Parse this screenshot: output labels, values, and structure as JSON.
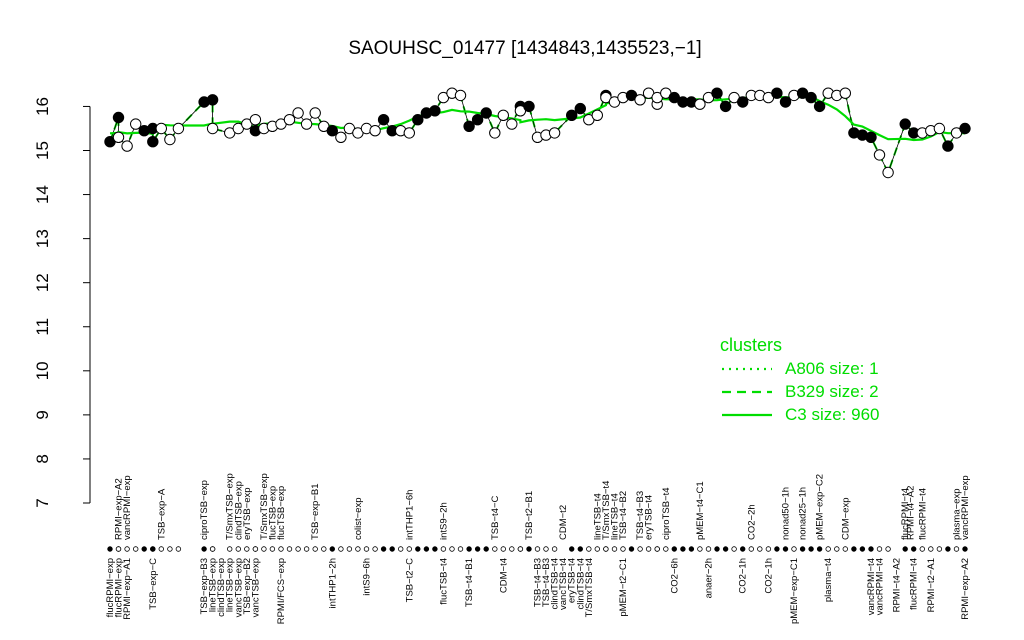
{
  "chart_data": {
    "type": "scatter",
    "title": "SAOUHSC_01477 [1434843,1435523,−1]",
    "xlabel": "",
    "ylabel": "",
    "ylim": [
      7,
      16.6
    ],
    "yticks": [
      7,
      8,
      9,
      10,
      11,
      12,
      13,
      14,
      15,
      16
    ],
    "x_count": 100,
    "top_labels": [
      {
        "i": 1,
        "label": "RPMI−exp−A2"
      },
      {
        "i": 2,
        "label": "vancRPMI−exp"
      },
      {
        "i": 6,
        "label": "TSB−exp−A"
      },
      {
        "i": 11,
        "label": "ciproTSB−exp"
      },
      {
        "i": 14,
        "label": "T/SmxTSB−exp"
      },
      {
        "i": 15,
        "label": "clindTSB−exp"
      },
      {
        "i": 16,
        "label": "eryTSB−exp"
      },
      {
        "i": 18,
        "label": "T/SmxTSB−exp"
      },
      {
        "i": 19,
        "label": "flucTSB−exp"
      },
      {
        "i": 20,
        "label": "flucTSB−exp"
      },
      {
        "i": 24,
        "label": "TSB−exp−B1"
      },
      {
        "i": 29,
        "label": "colist−exp"
      },
      {
        "i": 35,
        "label": "intTHP1−6h"
      },
      {
        "i": 39,
        "label": "intS9−2h"
      },
      {
        "i": 45,
        "label": "TSB−t4−C"
      },
      {
        "i": 49,
        "label": "TSB−t2−B1"
      },
      {
        "i": 53,
        "label": "CDM−t2"
      },
      {
        "i": 57,
        "label": "lineTSB−t4"
      },
      {
        "i": 58,
        "label": "T/SmxTSB−t4"
      },
      {
        "i": 59,
        "label": "lineTSB−t4"
      },
      {
        "i": 60,
        "label": "TSB−t4−B2"
      },
      {
        "i": 62,
        "label": "TSB−t4−B3"
      },
      {
        "i": 63,
        "label": "eryTSB−t4"
      },
      {
        "i": 65,
        "label": "ciproTSB−t4"
      },
      {
        "i": 69,
        "label": "pMEM−t4−C1"
      },
      {
        "i": 75,
        "label": "CO2−2h"
      },
      {
        "i": 79,
        "label": "nonad50−1h"
      },
      {
        "i": 81,
        "label": "nonad25−1h"
      },
      {
        "i": 83,
        "label": "pMEM−exp−C2"
      },
      {
        "i": 86,
        "label": "CDM−exp"
      },
      {
        "i": 93,
        "label": "flucRPMI−t4"
      },
      {
        "i": 93.6,
        "label": "RPMI−t4−A2"
      },
      {
        "i": 95,
        "label": "flucRPMI−t4"
      },
      {
        "i": 99,
        "label": "plasma−exp"
      },
      {
        "i": 100,
        "label": "vancRPMI−exp"
      }
    ],
    "bottom_labels": [
      {
        "i": 0,
        "label": "flucRPMI−exp"
      },
      {
        "i": 1,
        "label": "flucRPMI−exp"
      },
      {
        "i": 2,
        "label": "RPMI−exp−A1"
      },
      {
        "i": 5,
        "label": "TSB−exp−C"
      },
      {
        "i": 11,
        "label": "TSB−exp−B3"
      },
      {
        "i": 12,
        "label": "lineTSB−exp"
      },
      {
        "i": 13,
        "label": "clindTSB−exp"
      },
      {
        "i": 14,
        "label": "lineTSB−exp"
      },
      {
        "i": 15,
        "label": "vancTSB−exp"
      },
      {
        "i": 16,
        "label": "TSB−exp−B2"
      },
      {
        "i": 17,
        "label": "vancTSB−exp"
      },
      {
        "i": 20,
        "label": "RPMI/FCS−exp"
      },
      {
        "i": 26,
        "label": "intTHP1−2h"
      },
      {
        "i": 30,
        "label": "intS9−6h"
      },
      {
        "i": 35,
        "label": "TSB−t2−C"
      },
      {
        "i": 39,
        "label": "flucTSB−t4"
      },
      {
        "i": 42,
        "label": "TSB−t4−B1"
      },
      {
        "i": 46,
        "label": "CDM−t4"
      },
      {
        "i": 50,
        "label": "TSB−t4−B3"
      },
      {
        "i": 51,
        "label": "TSB−t4−B3"
      },
      {
        "i": 52,
        "label": "clindTSB−t4"
      },
      {
        "i": 53,
        "label": "vancTSB−t4"
      },
      {
        "i": 54,
        "label": "eryTSB−t4"
      },
      {
        "i": 55,
        "label": "clindTSB−t4"
      },
      {
        "i": 56,
        "label": "T/SmxTSB−t4"
      },
      {
        "i": 60,
        "label": "pMEM−t2−C1"
      },
      {
        "i": 66,
        "label": "CO2−6h"
      },
      {
        "i": 70,
        "label": "anaer−2h"
      },
      {
        "i": 74,
        "label": "CO2−1h"
      },
      {
        "i": 77,
        "label": "CO2−1h"
      },
      {
        "i": 80,
        "label": "pMEM−exp−C1"
      },
      {
        "i": 84,
        "label": "plasma−t4"
      },
      {
        "i": 89,
        "label": "vancRPMI−t4"
      },
      {
        "i": 90,
        "label": "vancRPMI−t4"
      },
      {
        "i": 92,
        "label": "RPMI−t4−A2"
      },
      {
        "i": 94,
        "label": "flucRPMI−t4"
      },
      {
        "i": 96,
        "label": "RPMI−t2−A1"
      },
      {
        "i": 100,
        "label": "RPMI−exp−A2"
      }
    ],
    "points": [
      [
        0,
        15.2,
        1
      ],
      [
        1,
        15.75,
        1
      ],
      [
        1,
        15.3,
        0
      ],
      [
        2,
        15.1,
        0
      ],
      [
        3,
        15.6,
        0
      ],
      [
        4,
        15.45,
        1
      ],
      [
        5,
        15.5,
        1
      ],
      [
        5,
        15.2,
        1
      ],
      [
        6,
        15.5,
        0
      ],
      [
        7,
        15.25,
        0
      ],
      [
        8,
        15.5,
        0
      ],
      [
        11,
        16.1,
        1
      ],
      [
        12,
        16.15,
        1
      ],
      [
        12,
        15.5,
        0
      ],
      [
        14,
        15.4,
        0
      ],
      [
        15,
        15.5,
        0
      ],
      [
        16,
        15.6,
        0
      ],
      [
        17,
        15.45,
        1
      ],
      [
        17,
        15.7,
        0
      ],
      [
        18,
        15.5,
        0
      ],
      [
        19,
        15.55,
        0
      ],
      [
        20,
        15.6,
        0
      ],
      [
        21,
        15.7,
        0
      ],
      [
        22,
        15.85,
        0
      ],
      [
        23,
        15.6,
        0
      ],
      [
        24,
        15.85,
        0
      ],
      [
        25,
        15.55,
        0
      ],
      [
        26,
        15.45,
        1
      ],
      [
        27,
        15.3,
        0
      ],
      [
        28,
        15.5,
        0
      ],
      [
        29,
        15.4,
        0
      ],
      [
        30,
        15.5,
        0
      ],
      [
        31,
        15.45,
        0
      ],
      [
        32,
        15.7,
        1
      ],
      [
        33,
        15.45,
        1
      ],
      [
        34,
        15.45,
        0
      ],
      [
        35,
        15.4,
        0
      ],
      [
        36,
        15.7,
        1
      ],
      [
        37,
        15.85,
        1
      ],
      [
        38,
        15.9,
        1
      ],
      [
        39,
        16.2,
        0
      ],
      [
        40,
        16.3,
        0
      ],
      [
        41,
        16.25,
        0
      ],
      [
        42,
        15.55,
        1
      ],
      [
        43,
        15.7,
        1
      ],
      [
        44,
        15.85,
        1
      ],
      [
        45,
        15.4,
        0
      ],
      [
        46,
        15.8,
        0
      ],
      [
        47,
        15.6,
        0
      ],
      [
        48,
        16.0,
        1
      ],
      [
        48,
        15.9,
        0
      ],
      [
        49,
        16.0,
        1
      ],
      [
        50,
        15.3,
        0
      ],
      [
        51,
        15.35,
        0
      ],
      [
        52,
        15.4,
        0
      ],
      [
        54,
        15.8,
        1
      ],
      [
        55,
        15.95,
        1
      ],
      [
        56,
        15.7,
        0
      ],
      [
        57,
        15.8,
        0
      ],
      [
        58,
        16.25,
        1
      ],
      [
        58,
        16.2,
        0
      ],
      [
        59,
        16.1,
        0
      ],
      [
        60,
        16.2,
        0
      ],
      [
        61,
        16.25,
        1
      ],
      [
        62,
        16.15,
        0
      ],
      [
        63,
        16.3,
        0
      ],
      [
        64,
        16.05,
        0
      ],
      [
        64,
        16.2,
        0
      ],
      [
        65,
        16.3,
        0
      ],
      [
        66,
        16.2,
        1
      ],
      [
        67,
        16.1,
        1
      ],
      [
        68,
        16.1,
        1
      ],
      [
        69,
        16.05,
        0
      ],
      [
        70,
        16.2,
        0
      ],
      [
        71,
        16.3,
        1
      ],
      [
        72,
        16.0,
        1
      ],
      [
        73,
        16.2,
        0
      ],
      [
        74,
        16.1,
        1
      ],
      [
        75,
        16.25,
        0
      ],
      [
        76,
        16.25,
        0
      ],
      [
        77,
        16.2,
        0
      ],
      [
        78,
        16.3,
        1
      ],
      [
        79,
        16.1,
        1
      ],
      [
        80,
        16.25,
        0
      ],
      [
        81,
        16.3,
        1
      ],
      [
        82,
        16.2,
        1
      ],
      [
        83,
        16.0,
        1
      ],
      [
        84,
        16.3,
        0
      ],
      [
        85,
        16.25,
        0
      ],
      [
        86,
        16.3,
        0
      ],
      [
        87,
        15.4,
        1
      ],
      [
        88,
        15.35,
        1
      ],
      [
        89,
        15.3,
        1
      ],
      [
        90,
        14.9,
        0
      ],
      [
        91,
        14.5,
        0
      ],
      [
        93,
        15.6,
        1
      ],
      [
        94,
        15.4,
        1
      ],
      [
        95,
        15.4,
        0
      ],
      [
        96,
        15.45,
        0
      ],
      [
        97,
        15.5,
        0
      ],
      [
        98,
        15.1,
        1
      ],
      [
        99,
        15.4,
        0
      ],
      [
        100,
        15.5,
        1
      ]
    ]
  },
  "legend": {
    "title": "clusters",
    "items": [
      {
        "label": "A806 size: 1",
        "style": "dotted"
      },
      {
        "label": "B329 size: 2",
        "style": "dashed"
      },
      {
        "label": "C3 size: 960",
        "style": "solid"
      }
    ]
  },
  "colors": {
    "series": "#00dd00",
    "point_fill_filled": "#000000",
    "point_fill_open": "#ffffff",
    "axis": "#000000"
  }
}
